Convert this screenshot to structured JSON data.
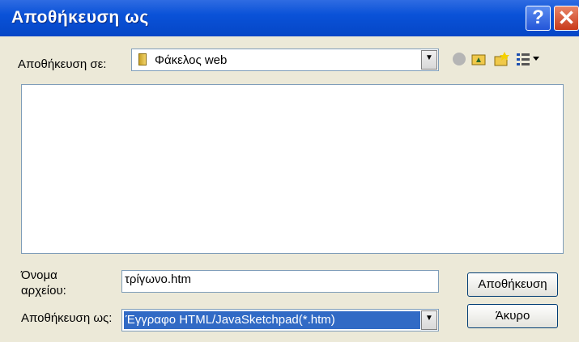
{
  "window": {
    "title": "Αποθήκευση ως"
  },
  "titlebar_buttons": {
    "help_label": "?",
    "close_label": "✕"
  },
  "location": {
    "label": "Αποθήκευση σε:",
    "value": "Φάκελος web",
    "folder_icon": "folder-icon"
  },
  "toolbar": {
    "icons": [
      "back-icon",
      "up-folder-icon",
      "new-folder-icon",
      "view-menu-icon"
    ]
  },
  "filename": {
    "label_line1": "Όνομα",
    "label_line2": "αρχείου:",
    "value": "τρίγωνο.htm"
  },
  "save_type": {
    "label": "Αποθήκευση ως:",
    "value": "Έγγραφο HTML/JavaSketchpad(*.htm)"
  },
  "buttons": {
    "save": "Αποθήκευση",
    "cancel": "Άκυρο"
  },
  "colors": {
    "titlebar": "#0a52d8",
    "dialog_bg": "#ece9d8",
    "selection": "#316ac5"
  }
}
